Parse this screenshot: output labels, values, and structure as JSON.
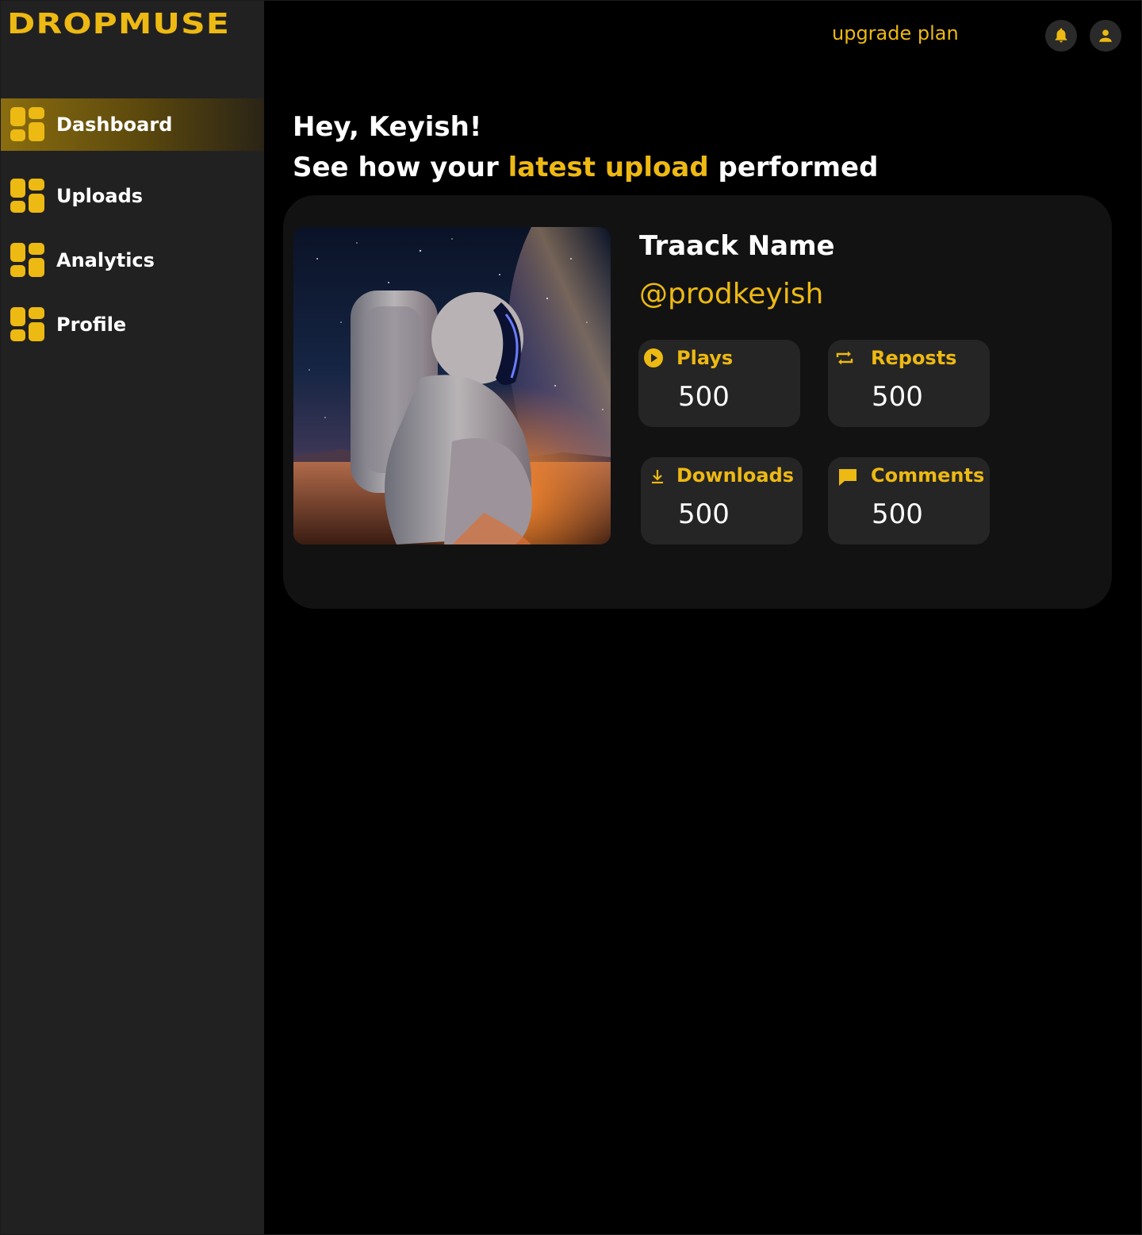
{
  "brand": {
    "logo_text": "DROPMUSE",
    "accent_color": "#EDB913"
  },
  "sidebar": {
    "items": [
      {
        "label": "Dashboard",
        "icon": "grid-icon",
        "active": true
      },
      {
        "label": "Uploads",
        "icon": "grid-icon",
        "active": false
      },
      {
        "label": "Analytics",
        "icon": "grid-icon",
        "active": false
      },
      {
        "label": "Profile",
        "icon": "grid-icon",
        "active": false
      }
    ]
  },
  "header": {
    "upgrade_label": "upgrade plan",
    "notifications_icon": "bell-icon",
    "account_icon": "user-icon"
  },
  "greeting": {
    "line1": "Hey, Keyish!",
    "line2_before": "See how your ",
    "line2_highlight": "latest upload",
    "line2_after": " performed"
  },
  "track": {
    "name": "Traack Name",
    "handle": "@prodkeyish",
    "artwork": "astronaut-artwork",
    "stats": [
      {
        "label": "Plays",
        "value": "500",
        "icon": "play-circle-icon"
      },
      {
        "label": "Reposts",
        "value": "500",
        "icon": "repost-icon"
      },
      {
        "label": "Downloads",
        "value": "500",
        "icon": "download-icon"
      },
      {
        "label": "Comments",
        "value": "500",
        "icon": "comment-icon"
      }
    ]
  }
}
